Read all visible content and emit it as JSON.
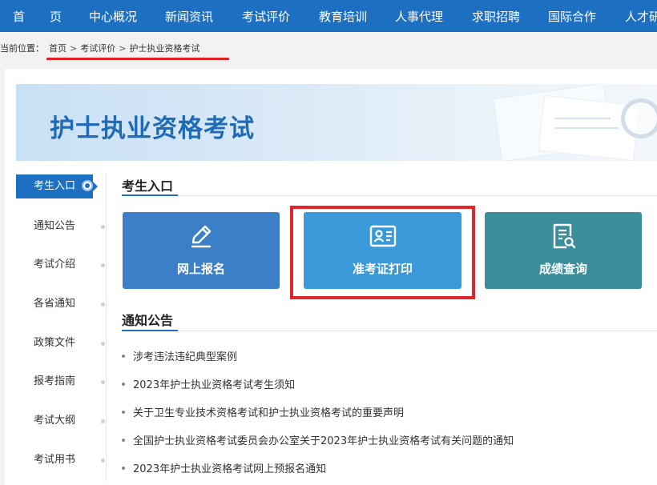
{
  "topnav": {
    "items": [
      "首",
      "页",
      "中心概况",
      "新闻资讯",
      "考试评价",
      "教育培训",
      "人事代理",
      "求职招聘",
      "国际合作",
      "人才研"
    ]
  },
  "breadcrumb": {
    "prefix": "当前位置：",
    "items": [
      "首页",
      "考试评价",
      "护士执业资格考试"
    ],
    "separator": ">"
  },
  "banner": {
    "title": "护士执业资格考试"
  },
  "sidebar": {
    "items": [
      "考生入口",
      "通知公告",
      "考试介绍",
      "各省通知",
      "政策文件",
      "报考指南",
      "考试大纲",
      "考试用书"
    ],
    "active_index": 0
  },
  "entry_section": {
    "title": "考生入口",
    "tiles": [
      {
        "label": "网上报名",
        "icon": "pencil-icon",
        "color": "#3b7fc8"
      },
      {
        "label": "准考证打印",
        "icon": "id-card-icon",
        "color": "#3a9ad9"
      },
      {
        "label": "成绩查询",
        "icon": "search-document-icon",
        "color": "#3c8f9a"
      }
    ]
  },
  "notice_section": {
    "title": "通知公告",
    "items": [
      "涉考违法违纪典型案例",
      "2023年护士执业资格考试考生须知",
      "关于卫生专业技术资格考试和护士执业资格考试的重要声明",
      "全国护士执业资格考试委员会办公室关于2023年护士执业资格考试有关问题的通知",
      "2023年护士执业资格考试网上预报名通知"
    ]
  },
  "colors": {
    "nav": "#1d6fc2",
    "highlight": "#e0262c"
  }
}
